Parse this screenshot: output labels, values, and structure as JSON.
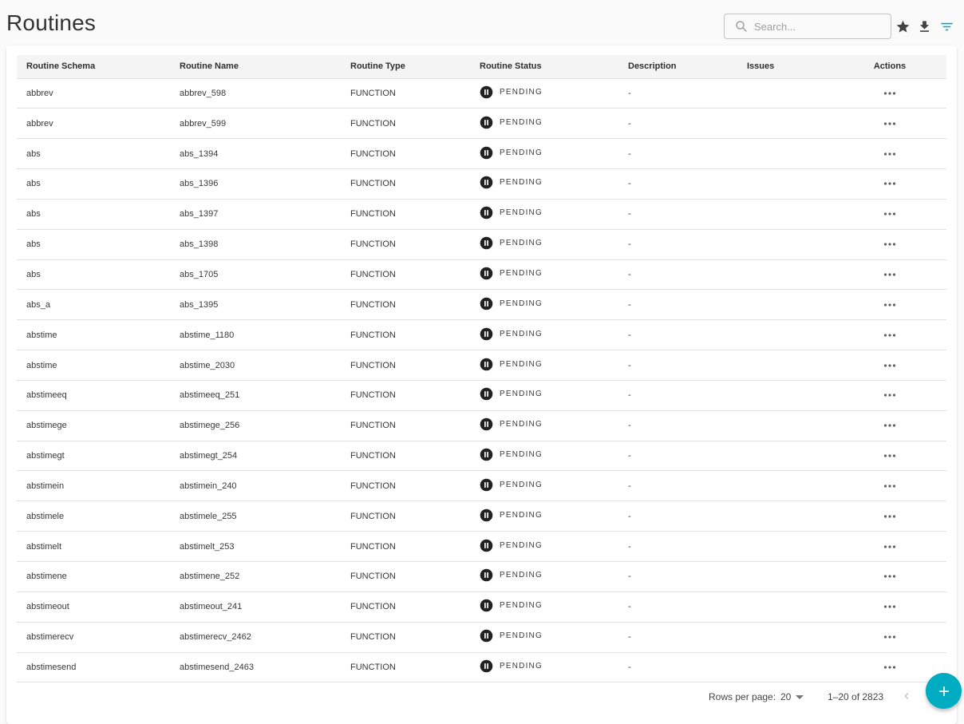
{
  "header": {
    "title": "Routines",
    "search_placeholder": "Search...",
    "search_value": "",
    "icons": [
      "search-icon",
      "star-icon",
      "download-icon",
      "filter-icon"
    ]
  },
  "colors": {
    "accent": "#00acc1",
    "status_icon": "#212121"
  },
  "table": {
    "columns": [
      "Routine Schema",
      "Routine Name",
      "Routine Type",
      "Routine Status",
      "Description",
      "Issues",
      "Actions"
    ],
    "rows": [
      {
        "schema": "abbrev",
        "name": "abbrev_598",
        "type": "FUNCTION",
        "status": "PENDING",
        "description": "-",
        "issues": ""
      },
      {
        "schema": "abbrev",
        "name": "abbrev_599",
        "type": "FUNCTION",
        "status": "PENDING",
        "description": "-",
        "issues": ""
      },
      {
        "schema": "abs",
        "name": "abs_1394",
        "type": "FUNCTION",
        "status": "PENDING",
        "description": "-",
        "issues": ""
      },
      {
        "schema": "abs",
        "name": "abs_1396",
        "type": "FUNCTION",
        "status": "PENDING",
        "description": "-",
        "issues": ""
      },
      {
        "schema": "abs",
        "name": "abs_1397",
        "type": "FUNCTION",
        "status": "PENDING",
        "description": "-",
        "issues": ""
      },
      {
        "schema": "abs",
        "name": "abs_1398",
        "type": "FUNCTION",
        "status": "PENDING",
        "description": "-",
        "issues": ""
      },
      {
        "schema": "abs",
        "name": "abs_1705",
        "type": "FUNCTION",
        "status": "PENDING",
        "description": "-",
        "issues": ""
      },
      {
        "schema": "abs_a",
        "name": "abs_1395",
        "type": "FUNCTION",
        "status": "PENDING",
        "description": "-",
        "issues": ""
      },
      {
        "schema": "abstime",
        "name": "abstime_1180",
        "type": "FUNCTION",
        "status": "PENDING",
        "description": "-",
        "issues": ""
      },
      {
        "schema": "abstime",
        "name": "abstime_2030",
        "type": "FUNCTION",
        "status": "PENDING",
        "description": "-",
        "issues": ""
      },
      {
        "schema": "abstimeeq",
        "name": "abstimeeq_251",
        "type": "FUNCTION",
        "status": "PENDING",
        "description": "-",
        "issues": ""
      },
      {
        "schema": "abstimege",
        "name": "abstimege_256",
        "type": "FUNCTION",
        "status": "PENDING",
        "description": "-",
        "issues": ""
      },
      {
        "schema": "abstimegt",
        "name": "abstimegt_254",
        "type": "FUNCTION",
        "status": "PENDING",
        "description": "-",
        "issues": ""
      },
      {
        "schema": "abstimein",
        "name": "abstimein_240",
        "type": "FUNCTION",
        "status": "PENDING",
        "description": "-",
        "issues": ""
      },
      {
        "schema": "abstimele",
        "name": "abstimele_255",
        "type": "FUNCTION",
        "status": "PENDING",
        "description": "-",
        "issues": ""
      },
      {
        "schema": "abstimelt",
        "name": "abstimelt_253",
        "type": "FUNCTION",
        "status": "PENDING",
        "description": "-",
        "issues": ""
      },
      {
        "schema": "abstimene",
        "name": "abstimene_252",
        "type": "FUNCTION",
        "status": "PENDING",
        "description": "-",
        "issues": ""
      },
      {
        "schema": "abstimeout",
        "name": "abstimeout_241",
        "type": "FUNCTION",
        "status": "PENDING",
        "description": "-",
        "issues": ""
      },
      {
        "schema": "abstimerecv",
        "name": "abstimerecv_2462",
        "type": "FUNCTION",
        "status": "PENDING",
        "description": "-",
        "issues": ""
      },
      {
        "schema": "abstimesend",
        "name": "abstimesend_2463",
        "type": "FUNCTION",
        "status": "PENDING",
        "description": "-",
        "issues": ""
      }
    ]
  },
  "pagination": {
    "rows_per_page_label": "Rows per page:",
    "rows_per_page_value": "20",
    "range_label": "1–20 of 2823"
  },
  "fab": {
    "icon": "plus-icon"
  }
}
